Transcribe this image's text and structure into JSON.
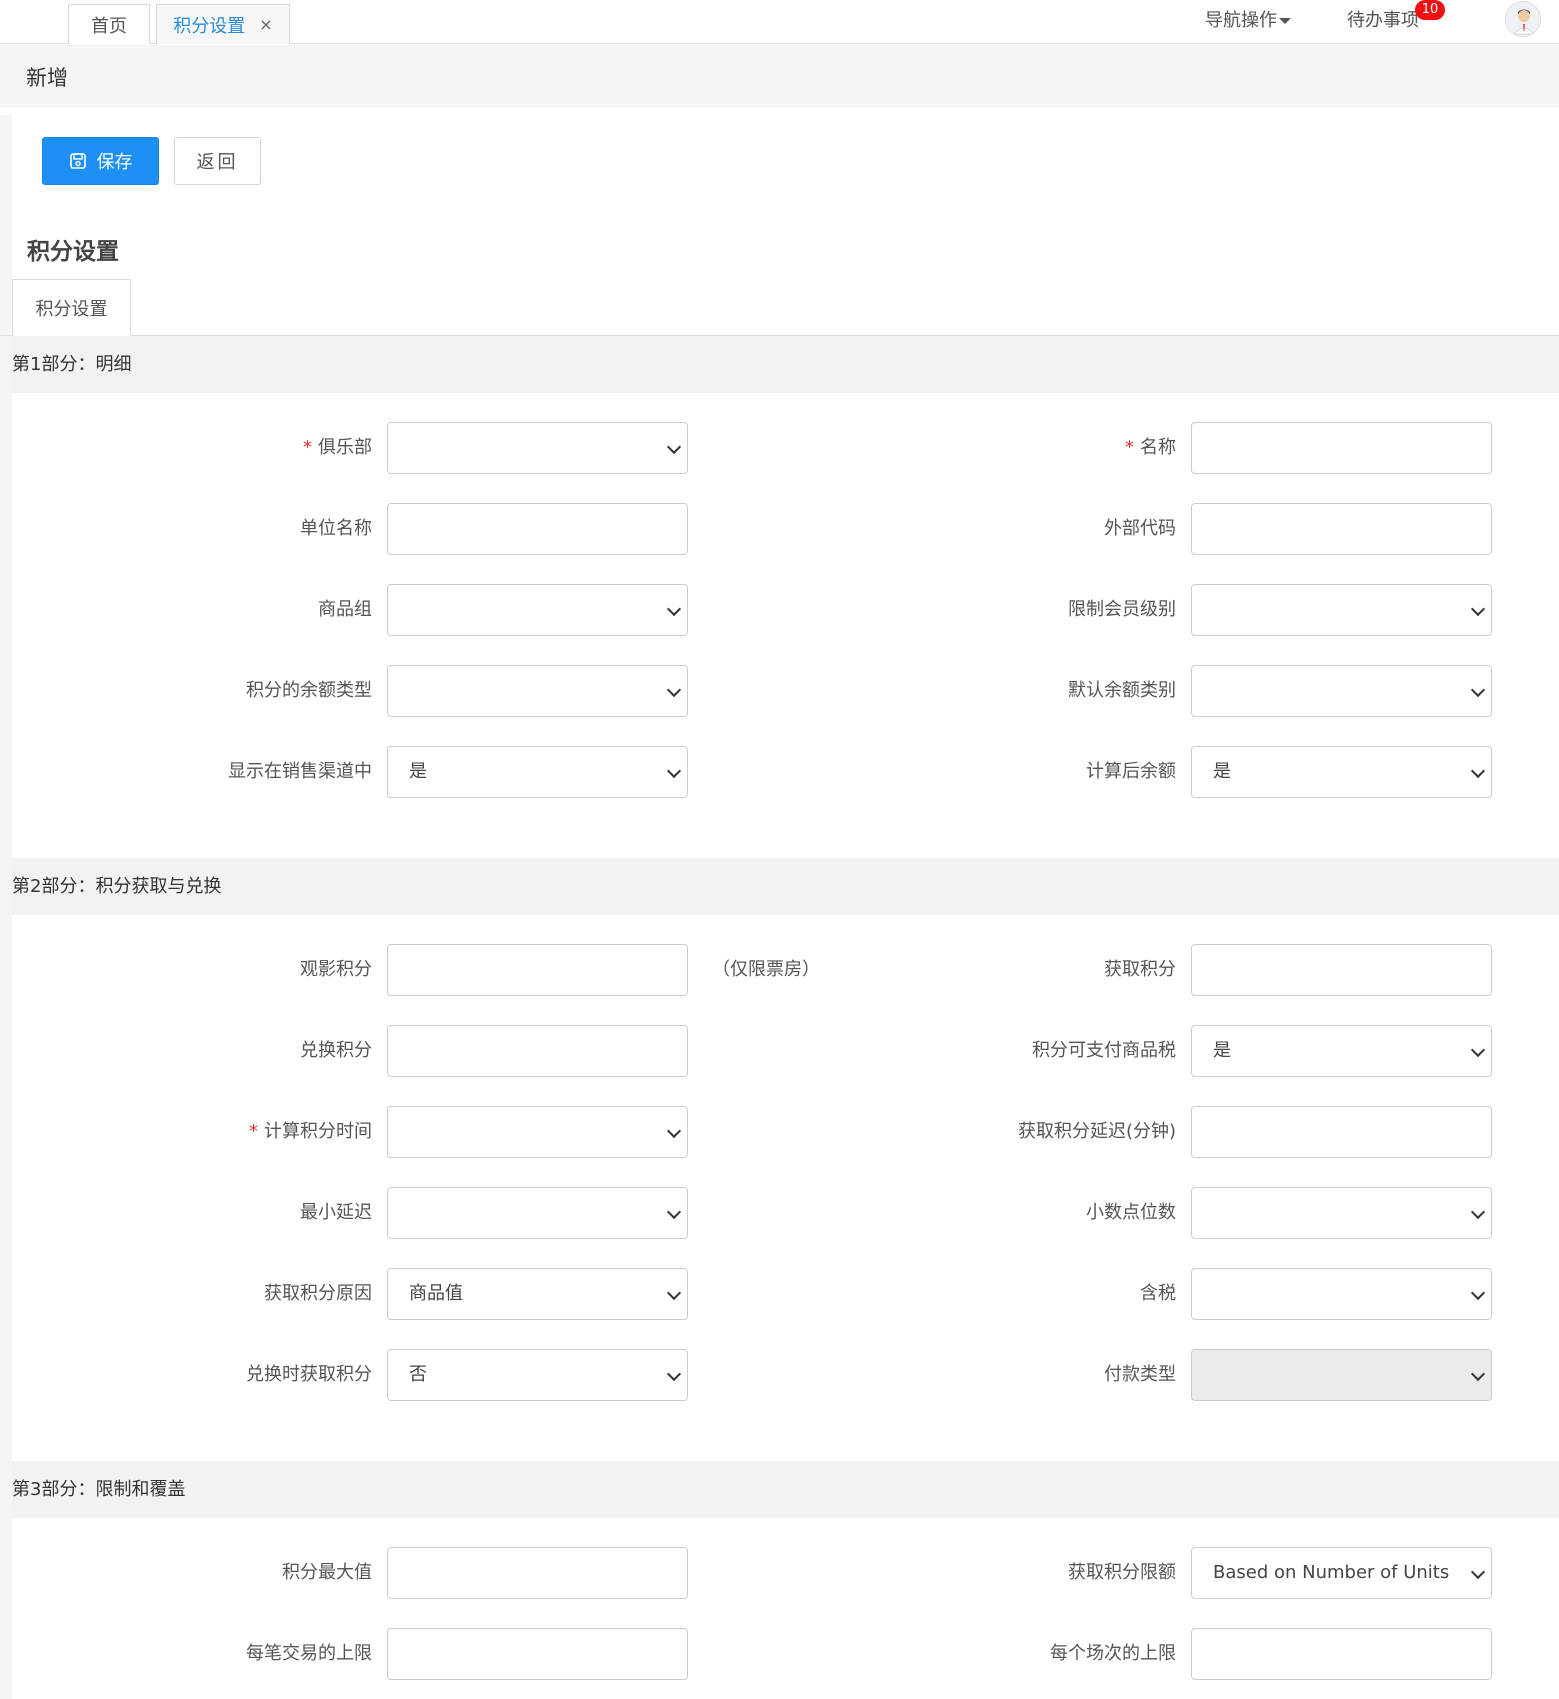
{
  "tabs": {
    "home": "首页",
    "points": "积分设置",
    "close": "×"
  },
  "topnav": {
    "nav_ops": "导航操作",
    "todo": "待办事项",
    "todo_count": "10"
  },
  "page": {
    "title": "新增",
    "section_title": "积分设置",
    "subtab": "积分设置"
  },
  "toolbar": {
    "save": "保存",
    "back": "返回"
  },
  "part1": {
    "header": "第1部分：明细",
    "club": {
      "label": "俱乐部",
      "value": ""
    },
    "name": {
      "label": "名称",
      "value": ""
    },
    "unit_name": {
      "label": "单位名称",
      "value": ""
    },
    "external_code": {
      "label": "外部代码",
      "value": ""
    },
    "product_group": {
      "label": "商品组",
      "value": ""
    },
    "member_level": {
      "label": "限制会员级别",
      "value": ""
    },
    "balance_type": {
      "label": "积分的余额类型",
      "value": ""
    },
    "default_balance": {
      "label": "默认余额类别",
      "value": ""
    },
    "show_in_channel": {
      "label": "显示在销售渠道中",
      "value": "是"
    },
    "calc_balance": {
      "label": "计算后余额",
      "value": "是"
    }
  },
  "part2": {
    "header": "第2部分：积分获取与兑换",
    "watch_points": {
      "label": "观影积分",
      "value": "",
      "note": "（仅限票房）"
    },
    "earn_points": {
      "label": "获取积分",
      "value": ""
    },
    "redeem_points": {
      "label": "兑换积分",
      "value": ""
    },
    "pay_tax": {
      "label": "积分可支付商品税",
      "value": "是"
    },
    "calc_time": {
      "label": "计算积分时间",
      "value": ""
    },
    "earn_delay": {
      "label": "获取积分延迟(分钟)",
      "value": ""
    },
    "min_delay": {
      "label": "最小延迟",
      "value": ""
    },
    "decimals": {
      "label": "小数点位数",
      "value": ""
    },
    "earn_reason": {
      "label": "获取积分原因",
      "value": "商品值"
    },
    "tax_included": {
      "label": "含税",
      "value": ""
    },
    "earn_on_redeem": {
      "label": "兑换时获取积分",
      "value": "否"
    },
    "payment_type": {
      "label": "付款类型",
      "value": ""
    }
  },
  "part3": {
    "header": "第3部分：限制和覆盖",
    "max_points": {
      "label": "积分最大值",
      "value": ""
    },
    "earn_limit": {
      "label": "获取积分限额",
      "value": "Based on Number of Units"
    },
    "per_txn_cap": {
      "label": "每笔交易的上限",
      "value": ""
    },
    "per_session_cap": {
      "label": "每个场次的上限",
      "value": ""
    }
  }
}
